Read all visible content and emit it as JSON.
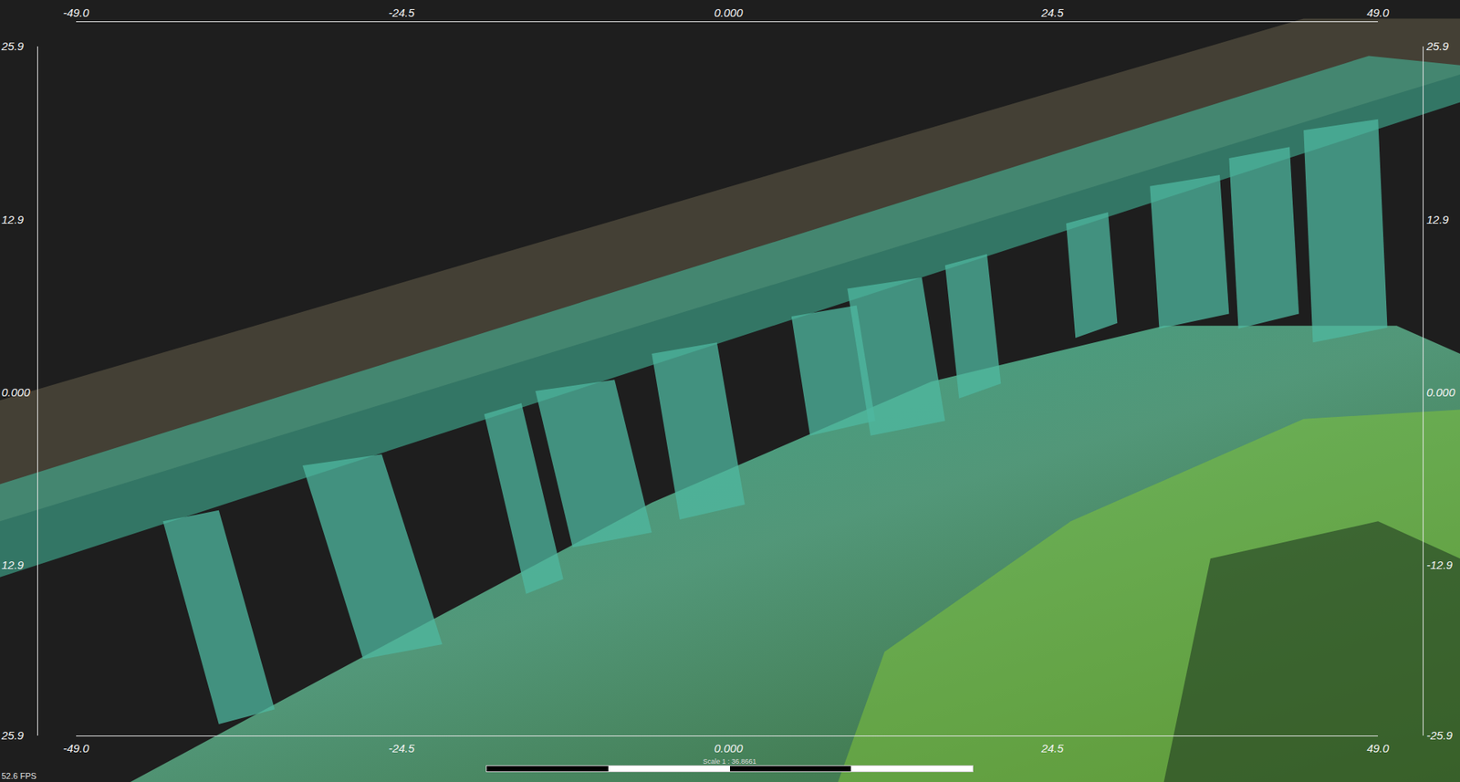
{
  "viewer": {
    "axes": {
      "top": [
        "-49.0",
        "-24.5",
        "0.000",
        "24.5",
        "49.0"
      ],
      "bottom": [
        "-49.0",
        "-24.5",
        "0.000",
        "24.5",
        "49.0"
      ],
      "left": [
        "25.9",
        "12.9",
        "0.000",
        "12.9",
        "25.9"
      ],
      "right": [
        "25.9",
        "12.9",
        "0.000",
        "-12.9",
        "-25.9"
      ]
    },
    "fps": "52.6 FPS",
    "scale_bar": {
      "label": "Scale 1 : 36.8661"
    }
  }
}
